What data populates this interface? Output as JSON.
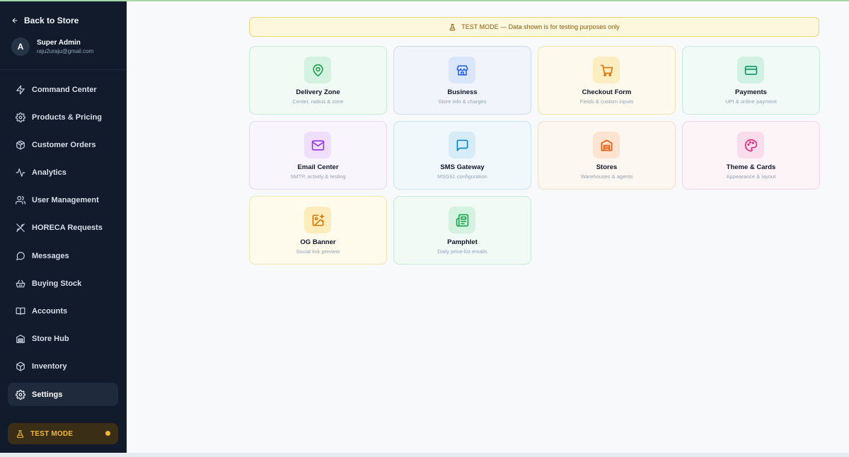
{
  "sidebar": {
    "back_label": "Back to Store",
    "profile": {
      "initial": "A",
      "name": "Super Admin",
      "email": "raju2uraju@gmail.com"
    },
    "items": [
      {
        "label": "Command Center",
        "icon": "zap-icon"
      },
      {
        "label": "Products & Pricing",
        "icon": "gear-icon"
      },
      {
        "label": "Customer Orders",
        "icon": "package-icon"
      },
      {
        "label": "Analytics",
        "icon": "activity-icon"
      },
      {
        "label": "User Management",
        "icon": "users-icon"
      },
      {
        "label": "HORECA Requests",
        "icon": "utensils-icon"
      },
      {
        "label": "Messages",
        "icon": "message-icon"
      },
      {
        "label": "Buying Stock",
        "icon": "basket-icon"
      },
      {
        "label": "Accounts",
        "icon": "book-icon"
      },
      {
        "label": "Store Hub",
        "icon": "warehouse-icon"
      },
      {
        "label": "Inventory",
        "icon": "box-icon"
      },
      {
        "label": "Settings",
        "icon": "gear-icon",
        "active": true
      }
    ],
    "test_mode_label": "TEST MODE"
  },
  "main": {
    "banner_text": "TEST MODE — Data shown is for testing purposes only",
    "cards": [
      {
        "title": "Delivery Zone",
        "subtitle": "Center, radius & zone",
        "icon": "map-pin-icon",
        "accent": "#16a34a"
      },
      {
        "title": "Business",
        "subtitle": "Store info & charges",
        "icon": "store-icon",
        "accent": "#2563eb"
      },
      {
        "title": "Checkout Form",
        "subtitle": "Fields & custom inputs",
        "icon": "cart-icon",
        "accent": "#d97706"
      },
      {
        "title": "Payments",
        "subtitle": "UPI & online payment",
        "icon": "credit-card-icon",
        "accent": "#059669"
      },
      {
        "title": "Email Center",
        "subtitle": "SMTP, activity & testing",
        "icon": "mail-icon",
        "accent": "#9333ea"
      },
      {
        "title": "SMS Gateway",
        "subtitle": "MSG91 configuration",
        "icon": "message-square-icon",
        "accent": "#0284c7"
      },
      {
        "title": "Stores",
        "subtitle": "Warehouses & agents",
        "icon": "warehouse-icon",
        "accent": "#ea580c"
      },
      {
        "title": "Theme & Cards",
        "subtitle": "Appearance & layout",
        "icon": "palette-icon",
        "accent": "#db2777"
      },
      {
        "title": "OG Banner",
        "subtitle": "Social link preview",
        "icon": "image-plus-icon",
        "accent": "#d97706"
      },
      {
        "title": "Pamphlet",
        "subtitle": "Daily price-list emails",
        "icon": "newspaper-icon",
        "accent": "#16a34a"
      }
    ]
  }
}
